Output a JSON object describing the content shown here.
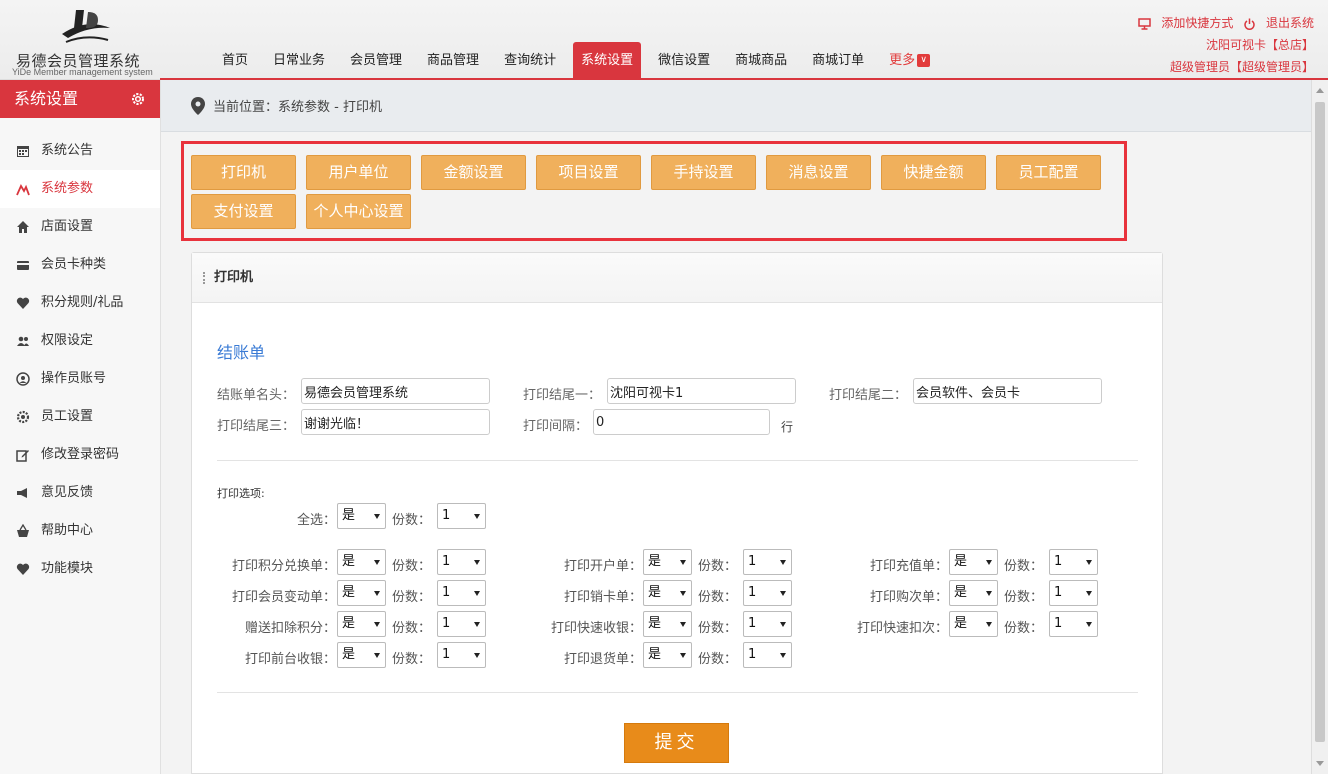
{
  "brand": {
    "title": "易德会员管理系统",
    "subtitle": "YiDe Member management system"
  },
  "nav": {
    "items": [
      "首页",
      "日常业务",
      "会员管理",
      "商品管理",
      "查询统计",
      "系统设置",
      "微信设置",
      "商城商品",
      "商城订单"
    ],
    "more_label": "更多",
    "active_index": 5
  },
  "top_right": {
    "add_shortcut": "添加快捷方式",
    "logout": "退出系统",
    "store": "沈阳可视卡【总店】",
    "user": "超级管理员【超级管理员】"
  },
  "sidebar": {
    "title": "系统设置",
    "items": [
      {
        "label": "系统公告",
        "icon": "calendar-icon"
      },
      {
        "label": "系统参数",
        "icon": "graph-icon"
      },
      {
        "label": "店面设置",
        "icon": "home-icon"
      },
      {
        "label": "会员卡种类",
        "icon": "card-icon"
      },
      {
        "label": "积分规则/礼品",
        "icon": "heart-icon"
      },
      {
        "label": "权限设定",
        "icon": "users-icon"
      },
      {
        "label": "操作员账号",
        "icon": "user-circle-icon"
      },
      {
        "label": "员工设置",
        "icon": "gear-icon"
      },
      {
        "label": "修改登录密码",
        "icon": "edit-icon"
      },
      {
        "label": "意见反馈",
        "icon": "megaphone-icon"
      },
      {
        "label": "帮助中心",
        "icon": "basket-icon"
      },
      {
        "label": "功能模块",
        "icon": "heart-icon"
      }
    ],
    "active_index": 1
  },
  "breadcrumb": "当前位置：系统参数 - 打印机",
  "tabs": [
    "打印机",
    "用户单位",
    "金额设置",
    "项目设置",
    "手持设置",
    "消息设置",
    "快捷金额",
    "员工配置",
    "支付设置",
    "个人中心设置"
  ],
  "panel": {
    "title": "打印机",
    "section_title": "结账单",
    "fields": {
      "receipt_name_label": "结账单名头：",
      "receipt_name_value": "易德会员管理系统",
      "footer1_label": "打印结尾一：",
      "footer1_value": "沈阳可视卡1",
      "footer2_label": "打印结尾二：",
      "footer2_value": "会员软件、会员卡",
      "footer3_label": "打印结尾三：",
      "footer3_value": "谢谢光临！",
      "interval_label": "打印间隔：",
      "interval_value": "0",
      "interval_unit": "行"
    },
    "options_title": "打印选项:",
    "select_all_label": "全选：",
    "copies_label": "份数：",
    "yes": "是",
    "one": "1",
    "options": [
      {
        "label": "打印积分兑换单：",
        "value": "是",
        "copies": "1"
      },
      {
        "label": "打印开户单：",
        "value": "是",
        "copies": "1"
      },
      {
        "label": "打印充值单：",
        "value": "是",
        "copies": "1"
      },
      {
        "label": "打印会员变动单：",
        "value": "是",
        "copies": "1"
      },
      {
        "label": "打印销卡单：",
        "value": "是",
        "copies": "1"
      },
      {
        "label": "打印购次单：",
        "value": "是",
        "copies": "1"
      },
      {
        "label": "赠送扣除积分：",
        "value": "是",
        "copies": "1"
      },
      {
        "label": "打印快速收银：",
        "value": "是",
        "copies": "1"
      },
      {
        "label": "打印快速扣次：",
        "value": "是",
        "copies": "1"
      },
      {
        "label": "打印前台收银：",
        "value": "是",
        "copies": "1"
      },
      {
        "label": "打印退货单：",
        "value": "是",
        "copies": "1"
      }
    ],
    "submit": "提交"
  },
  "colors": {
    "accent": "#d9363e",
    "tab_orange": "#f0b05c",
    "submit_orange": "#e88b1a",
    "section_blue": "#3a7bd5"
  }
}
